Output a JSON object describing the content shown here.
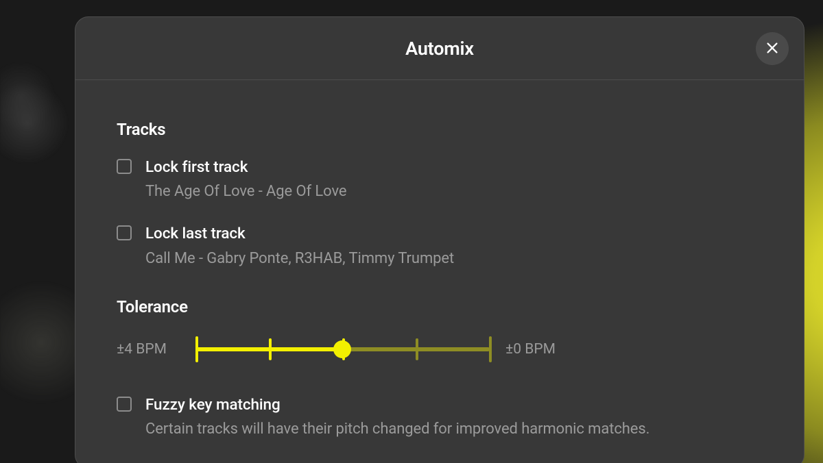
{
  "colors": {
    "accent": "#f3f000",
    "accent_dim": "#8e8d24",
    "panel": "#383838",
    "text": "#ffffff",
    "text_muted": "#9b9b9b"
  },
  "modal": {
    "title": "Automix",
    "close_icon": "close-icon"
  },
  "sections": {
    "tracks": {
      "title": "Tracks",
      "options": [
        {
          "id": "lock-first-track",
          "label": "Lock first track",
          "subtext": "The Age Of Love - Age Of Love",
          "checked": false
        },
        {
          "id": "lock-last-track",
          "label": "Lock last track",
          "subtext": "Call Me - Gabry Ponte, R3HAB, Timmy Trumpet",
          "checked": false
        }
      ]
    },
    "tolerance": {
      "title": "Tolerance",
      "slider": {
        "min_label": "±4 BPM",
        "max_label": "±0 BPM",
        "value_percent": 50,
        "ticks_percent": [
          0,
          25,
          50,
          75,
          100
        ]
      },
      "fuzzy": {
        "id": "fuzzy-key-matching",
        "label": "Fuzzy key matching",
        "subtext": "Certain tracks will have their pitch changed for improved harmonic matches.",
        "checked": false
      }
    }
  }
}
